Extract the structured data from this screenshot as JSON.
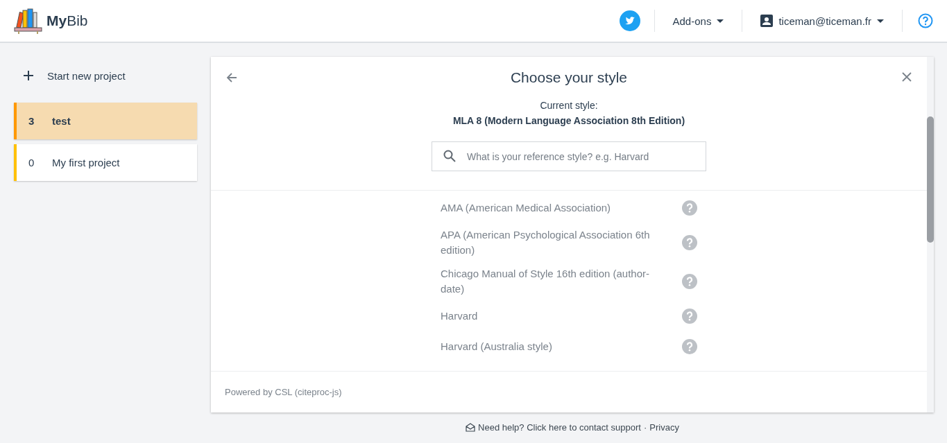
{
  "header": {
    "brand": {
      "bold": "My",
      "light": "Bib"
    },
    "addons": "Add-ons",
    "account": "ticeman@ticeman.fr"
  },
  "sidebar": {
    "new_project": "Start new project",
    "projects": [
      {
        "count": "3",
        "name": "test",
        "selected": true,
        "color": "#ff9800"
      },
      {
        "count": "0",
        "name": "My first project",
        "selected": false,
        "color": "#ffc107"
      }
    ]
  },
  "dialog": {
    "title": "Choose your style",
    "current_label": "Current style:",
    "current_style": "MLA 8 (Modern Language Association 8th Edition)",
    "search": {
      "placeholder": "What is your reference style? e.g. Harvard"
    },
    "styles": [
      "AMA (American Medical Association)",
      "APA (American Psychological Association 6th edition)",
      "Chicago Manual of Style 16th edition (author-date)",
      "Harvard",
      "Harvard (Australia style)"
    ],
    "footer": "Powered by CSL (citeproc-js)"
  },
  "page_footer": {
    "help": "Need help? Click here to contact support",
    "separator": "·",
    "privacy": "Privacy"
  }
}
